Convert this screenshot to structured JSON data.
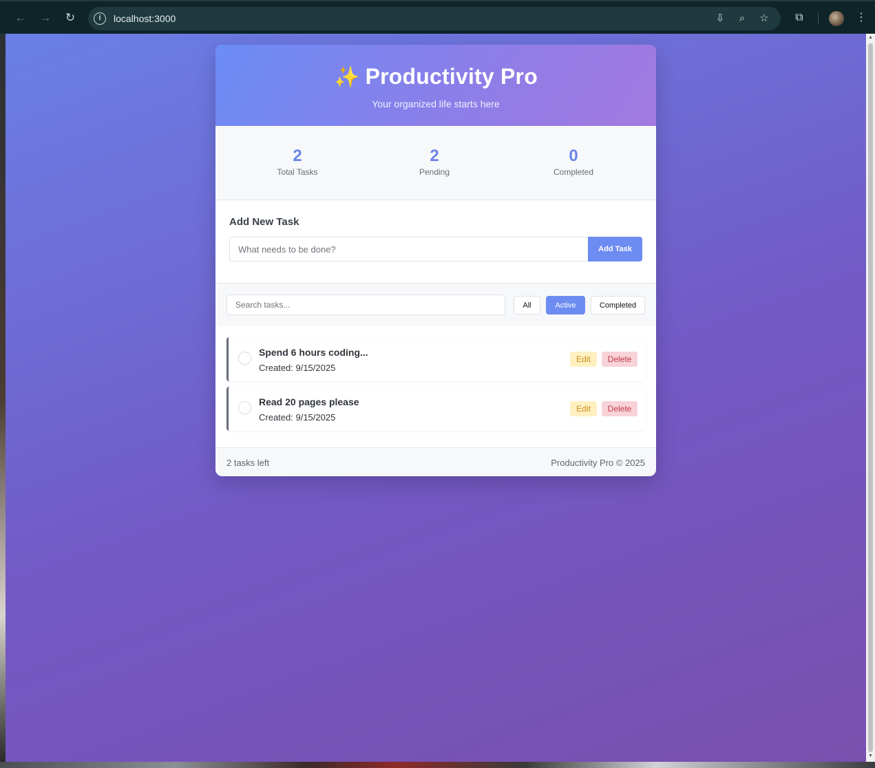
{
  "browser": {
    "url": "localhost:3000",
    "icons": {
      "back": "arrow-left-icon",
      "forward": "arrow-right-icon",
      "reload": "reload-icon",
      "site_info": "info-icon",
      "install": "install-icon",
      "zoom": "zoom-icon",
      "bookmark": "star-icon",
      "extensions": "puzzle-icon",
      "menu": "kebab-menu-icon"
    }
  },
  "app": {
    "title": "Productivity Pro",
    "subtitle": "Your organized life starts here",
    "accent_color": "#6d8cf2"
  },
  "stats": [
    {
      "value": "2",
      "label": "Total Tasks"
    },
    {
      "value": "2",
      "label": "Pending"
    },
    {
      "value": "0",
      "label": "Completed"
    }
  ],
  "add_task": {
    "heading": "Add New Task",
    "placeholder": "What needs to be done?",
    "button": "Add Task"
  },
  "filters": {
    "search_placeholder": "Search tasks...",
    "buttons": [
      "All",
      "Active",
      "Completed"
    ],
    "active": "Active"
  },
  "tasks": [
    {
      "title": "Spend 6 hours coding...",
      "created": "Created: 9/15/2025",
      "edit": "Edit",
      "delete": "Delete"
    },
    {
      "title": "Read 20 pages please",
      "created": "Created: 9/15/2025",
      "edit": "Edit",
      "delete": "Delete"
    }
  ],
  "footer": {
    "left": "2 tasks left",
    "right": "Productivity Pro © 2025"
  }
}
